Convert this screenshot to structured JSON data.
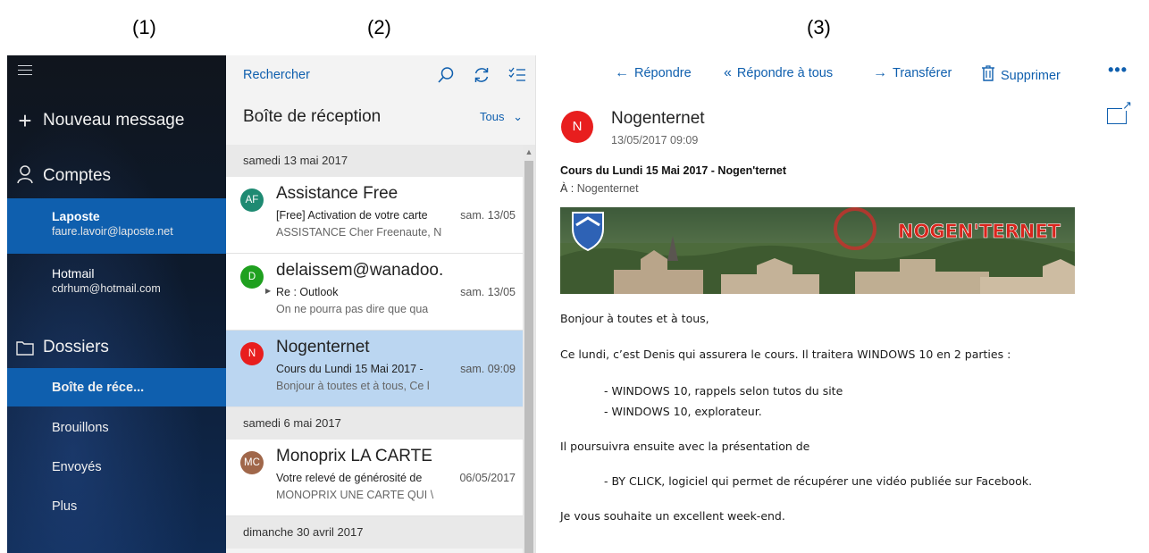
{
  "labels": {
    "pane1": "(1)",
    "pane2": "(2)",
    "pane3": "(3)"
  },
  "nav": {
    "new_message": "Nouveau message",
    "accounts_heading": "Comptes",
    "accounts": [
      {
        "name": "Laposte",
        "email": "faure.lavoir@laposte.net",
        "selected": true
      },
      {
        "name": "Hotmail",
        "email": "cdrhum@hotmail.com",
        "selected": false
      }
    ],
    "folders_heading": "Dossiers",
    "folders": [
      {
        "label": "Boîte de réce...",
        "selected": true
      },
      {
        "label": "Brouillons",
        "selected": false
      },
      {
        "label": "Envoyés",
        "selected": false
      },
      {
        "label": "Plus",
        "selected": false
      }
    ]
  },
  "list": {
    "search_label": "Rechercher",
    "inbox_title": "Boîte de réception",
    "filter": "Tous",
    "groups": [
      {
        "date": "samedi 13 mai 2017",
        "messages": [
          {
            "initials": "AF",
            "avatar_color": "#1e8a72",
            "sender": "Assistance Free",
            "subject": "[Free] Activation de votre carte",
            "date": "sam. 13/05",
            "preview": "ASSISTANCE Cher Freenaute, N",
            "thread": false,
            "selected": false
          },
          {
            "initials": "D",
            "avatar_color": "#1fa01f",
            "sender": "delaissem@wanadoo.",
            "subject": "Re : Outlook",
            "date": "sam. 13/05",
            "preview": "On ne pourra pas dire que qua",
            "thread": true,
            "selected": false
          },
          {
            "initials": "N",
            "avatar_color": "#e81e1e",
            "sender": "Nogenternet",
            "subject": "Cours du Lundi 15 Mai 2017 -",
            "date": "sam. 09:09",
            "preview": "Bonjour à toutes et à tous, Ce l",
            "thread": false,
            "selected": true
          }
        ]
      },
      {
        "date": "samedi 6 mai 2017",
        "messages": [
          {
            "initials": "MC",
            "avatar_color": "#a0674a",
            "sender": "Monoprix LA CARTE",
            "subject": "Votre relevé de générosité de",
            "date": "06/05/2017",
            "preview": "MONOPRIX UNE CARTE QUI \\",
            "thread": false,
            "selected": false
          }
        ]
      },
      {
        "date": "dimanche 30 avril 2017",
        "messages": []
      }
    ]
  },
  "reader": {
    "toolbar": {
      "reply": "Répondre",
      "reply_all": "Répondre à tous",
      "forward": "Transférer",
      "delete": "Supprimer",
      "more": "•••"
    },
    "from_initial": "N",
    "from": "Nogenternet",
    "datetime": "13/05/2017 09:09",
    "subject": "Cours du Lundi 15 Mai 2017 - Nogen'ternet",
    "to_label": "À :",
    "to": "Nogenternet",
    "banner_text": "NOGEN'TERNET",
    "body": {
      "greeting": "Bonjour à toutes et à tous,",
      "p1": "Ce lundi, c’est Denis qui assurera le cours. Il traitera WINDOWS 10 en 2 parties :",
      "item1": "- WINDOWS 10, rappels selon tutos du site",
      "item2": "- WINDOWS 10, explorateur.",
      "p2": "Il poursuivra ensuite avec la présentation de",
      "item3": "-  BY CLICK, logiciel qui permet de récupérer une vidéo publiée sur Facebook.",
      "closing": "Je vous souhaite un excellent week-end."
    }
  },
  "colors": {
    "accent": "#0f5fae",
    "selected_row": "#bbd6f1",
    "nav_dark": "#10151d"
  }
}
